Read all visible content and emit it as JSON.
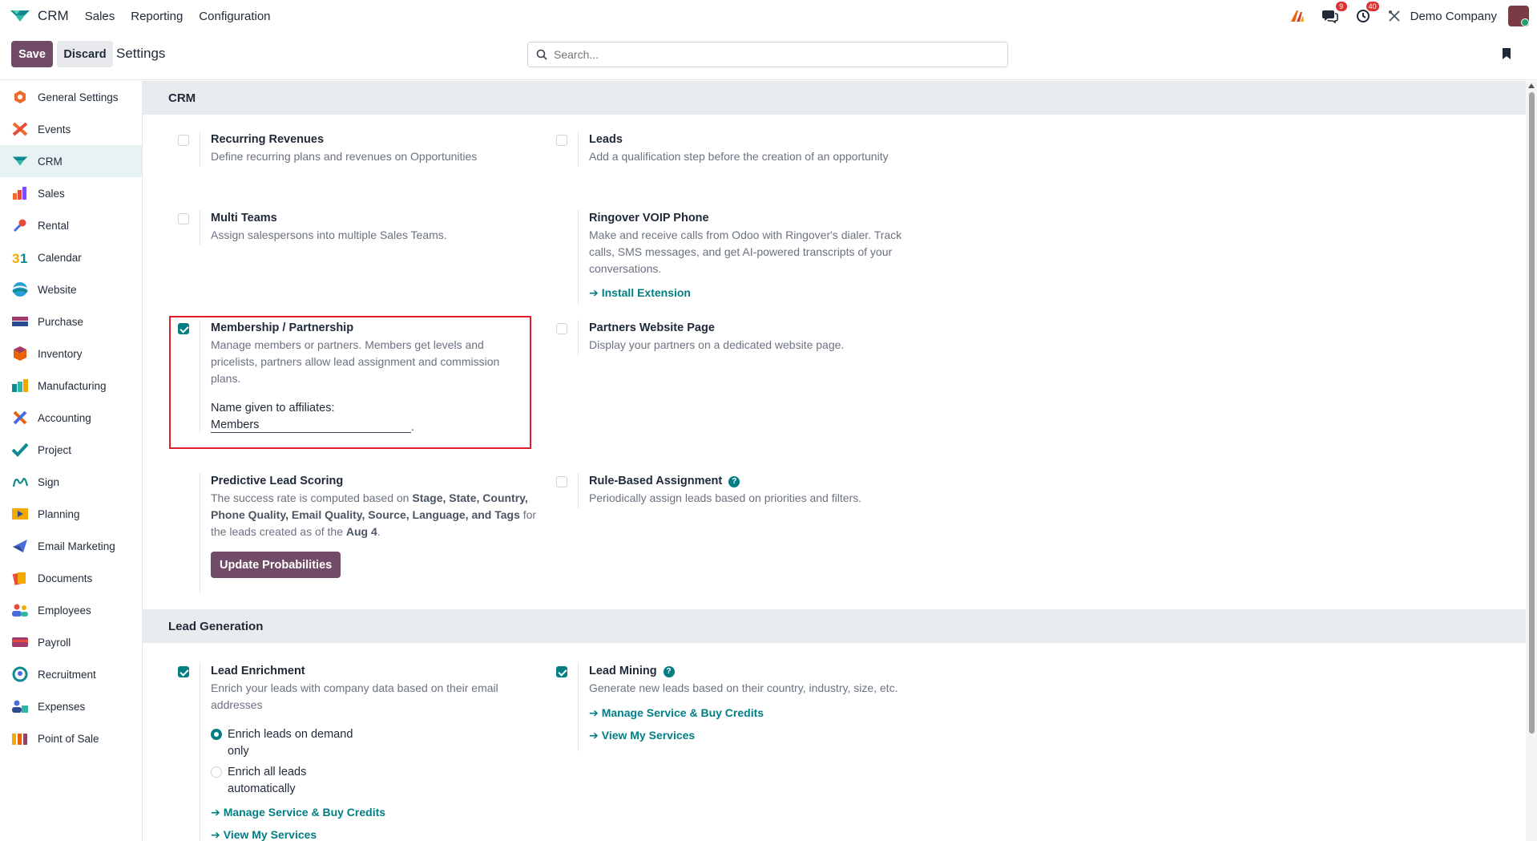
{
  "navbar": {
    "app_name": "CRM",
    "menu": [
      "Sales",
      "Reporting",
      "Configuration"
    ],
    "messages_count": "9",
    "activities_count": "40",
    "company": "Demo Company"
  },
  "control": {
    "save_label": "Save",
    "discard_label": "Discard",
    "title": "Settings",
    "search_placeholder": "Search..."
  },
  "sidebar": {
    "items": [
      {
        "label": "General Settings",
        "icon": "general-settings-icon"
      },
      {
        "label": "Events",
        "icon": "events-icon"
      },
      {
        "label": "CRM",
        "icon": "crm-icon"
      },
      {
        "label": "Sales",
        "icon": "sales-icon"
      },
      {
        "label": "Rental",
        "icon": "rental-icon"
      },
      {
        "label": "Calendar",
        "icon": "calendar-icon"
      },
      {
        "label": "Website",
        "icon": "website-icon"
      },
      {
        "label": "Purchase",
        "icon": "purchase-icon"
      },
      {
        "label": "Inventory",
        "icon": "inventory-icon"
      },
      {
        "label": "Manufacturing",
        "icon": "manufacturing-icon"
      },
      {
        "label": "Accounting",
        "icon": "accounting-icon"
      },
      {
        "label": "Project",
        "icon": "project-icon"
      },
      {
        "label": "Sign",
        "icon": "sign-icon"
      },
      {
        "label": "Planning",
        "icon": "planning-icon"
      },
      {
        "label": "Email Marketing",
        "icon": "email-marketing-icon"
      },
      {
        "label": "Documents",
        "icon": "documents-icon"
      },
      {
        "label": "Employees",
        "icon": "employees-icon"
      },
      {
        "label": "Payroll",
        "icon": "payroll-icon"
      },
      {
        "label": "Recruitment",
        "icon": "recruitment-icon"
      },
      {
        "label": "Expenses",
        "icon": "expenses-icon"
      },
      {
        "label": "Point of Sale",
        "icon": "point-of-sale-icon"
      }
    ],
    "active": "CRM"
  },
  "crm": {
    "heading": "CRM",
    "recurring": {
      "title": "Recurring Revenues",
      "desc": "Define recurring plans and revenues on Opportunities",
      "checked": false
    },
    "leads": {
      "title": "Leads",
      "desc": "Add a qualification step before the creation of an opportunity",
      "checked": false
    },
    "multi_teams": {
      "title": "Multi Teams",
      "desc": "Assign salespersons into multiple Sales Teams.",
      "checked": false
    },
    "ringover": {
      "title": "Ringover VOIP Phone",
      "desc": "Make and receive calls from Odoo with Ringover's dialer. Track calls, SMS messages, and get AI-powered transcripts of your conversations.",
      "link": "Install Extension"
    },
    "membership": {
      "title": "Membership / Partnership",
      "desc": "Manage members or partners. Members get levels and pricelists, partners allow lead assignment and commission plans.",
      "checked": true,
      "field_label": "Name given to affiliates:",
      "field_value": "Members",
      "field_suffix": "."
    },
    "partners_page": {
      "title": "Partners Website Page",
      "desc": "Display your partners on a dedicated website page.",
      "checked": false
    },
    "predictive": {
      "title": "Predictive Lead Scoring",
      "desc_1": "The success rate is computed based on ",
      "desc_bold_1": "Stage, State, Country, Phone Quality, Email Quality, Source, Language, and Tags",
      "desc_2": " for the leads created as of the ",
      "desc_bold_2": "Aug 4",
      "desc_3": ".",
      "button": "Update Probabilities"
    },
    "rule_based": {
      "title": "Rule-Based Assignment",
      "desc": "Periodically assign leads based on priorities and filters.",
      "checked": false
    }
  },
  "lead_gen": {
    "heading": "Lead Generation",
    "enrichment": {
      "title": "Lead Enrichment",
      "desc": "Enrich your leads with company data based on their email addresses",
      "checked": true,
      "options": [
        "Enrich leads on demand only",
        "Enrich all leads automatically"
      ],
      "selected": 0,
      "link_1": "Manage Service & Buy Credits",
      "link_2": "View My Services"
    },
    "mining": {
      "title": "Lead Mining",
      "desc": "Generate new leads based on their country, industry, size, etc.",
      "checked": true,
      "link_1": "Manage Service & Buy Credits",
      "link_2": "View My Services"
    }
  },
  "colors": {
    "brand": "#714b67",
    "accent": "#017e84",
    "highlight": "#e11d2a"
  }
}
